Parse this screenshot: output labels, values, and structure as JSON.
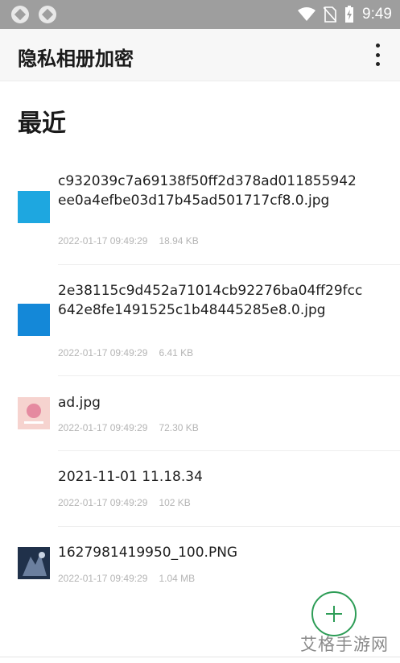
{
  "status_bar": {
    "time": "9:49",
    "icons": [
      "app-icon-1",
      "app-icon-2",
      "wifi-icon",
      "no-sim-icon",
      "battery-charging-icon"
    ]
  },
  "app_bar": {
    "title": "隐私相册加密",
    "menu_icon": "more-vert-icon"
  },
  "section": {
    "title": "最近"
  },
  "files": [
    {
      "name": "c932039c7a69138f50ff2d378ad011855942ee0a4efbe03d17b45ad501717cf8.0.jpg",
      "date": "2022-01-17 09:49:29",
      "size": "18.94 KB",
      "thumb_color": "#1ea7e0",
      "thumb": "blue-image-thumbnail"
    },
    {
      "name": "2e38115c9d452a71014cb92276ba04ff29fcc642e8fe1491525c1b48445285e8.0.jpg",
      "date": "2022-01-17 09:49:29",
      "size": "6.41 KB",
      "thumb_color": "#1488d8",
      "thumb": "blue-image-thumbnail"
    },
    {
      "name": "ad.jpg",
      "date": "2022-01-17 09:49:29",
      "size": "72.30 KB",
      "thumb_color": "#f6d3cf",
      "thumb": "pink-ad-thumbnail"
    },
    {
      "name": "2021-11-01 11.18.34",
      "date": "2022-01-17 09:49:29",
      "size": "102 KB",
      "thumb_color": "#ffffff",
      "thumb": "blank-thumbnail"
    },
    {
      "name": "1627981419950_100.PNG",
      "date": "2022-01-17 09:49:29",
      "size": "1.04 MB",
      "thumb_color": "#20314a",
      "thumb": "dark-game-thumbnail"
    }
  ],
  "fab": {
    "icon": "plus-icon",
    "accent": "#2e9d57"
  },
  "watermark": {
    "text": "艾格手游网"
  }
}
